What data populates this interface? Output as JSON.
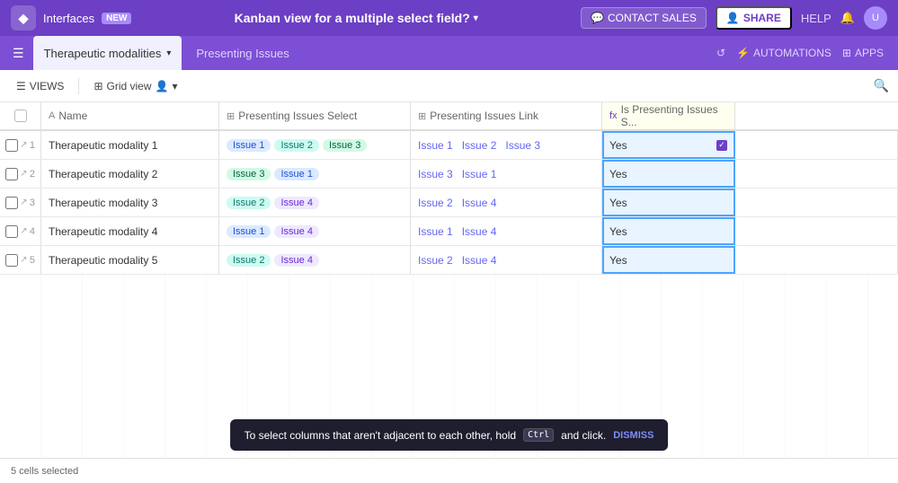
{
  "nav": {
    "logo": "◆",
    "interfaces_label": "Interfaces",
    "new_badge": "NEW",
    "title": "Kanban view for a multiple select field?",
    "title_caret": "▾",
    "contact_sales_label": "CONTACT SALES",
    "share_label": "SHARE",
    "help_label": "HELP",
    "share_icon": "👤"
  },
  "tabs": {
    "active_tab": "Therapeutic modalities",
    "active_tab_arrow": "▾",
    "inactive_tab": "Presenting Issues",
    "hamburger": "☰",
    "automations": "AUTOMATIONS",
    "apps": "APPS",
    "history_icon": "↺"
  },
  "toolbar": {
    "views_label": "VIEWS",
    "grid_view_label": "Grid view",
    "grid_view_icon": "⊞",
    "users_icon": "👤",
    "dropdown_arrow": "▾",
    "search_icon": "🔍"
  },
  "columns": {
    "checkbox": "",
    "name": "Name",
    "name_icon": "A",
    "select": "Presenting Issues Select",
    "select_icon": "⊞",
    "link": "Presenting Issues Link",
    "link_icon": "⊞",
    "formula": "Is Presenting Issues S...",
    "formula_icon": "fx"
  },
  "rows": [
    {
      "num": "1",
      "name": "Therapeutic modality 1",
      "tags_select": [
        {
          "label": "Issue 1",
          "color": "blue"
        },
        {
          "label": "Issue 2",
          "color": "teal"
        },
        {
          "label": "Issue 3",
          "color": "green"
        }
      ],
      "links": [
        "Issue 1",
        "Issue 2",
        "Issue 3"
      ],
      "formula": "Yes",
      "selected": true
    },
    {
      "num": "2",
      "name": "Therapeutic modality 2",
      "tags_select": [
        {
          "label": "Issue 3",
          "color": "green"
        },
        {
          "label": "Issue 1",
          "color": "blue"
        }
      ],
      "links": [
        "Issue 3",
        "Issue 1"
      ],
      "formula": "Yes",
      "selected": true
    },
    {
      "num": "3",
      "name": "Therapeutic modality 3",
      "tags_select": [
        {
          "label": "Issue 2",
          "color": "teal"
        },
        {
          "label": "Issue 4",
          "color": "purple"
        }
      ],
      "links": [
        "Issue 2",
        "Issue 4"
      ],
      "formula": "Yes",
      "selected": true
    },
    {
      "num": "4",
      "name": "Therapeutic modality 4",
      "tags_select": [
        {
          "label": "Issue 1",
          "color": "blue"
        },
        {
          "label": "Issue 4",
          "color": "purple"
        }
      ],
      "links": [
        "Issue 1",
        "Issue 4"
      ],
      "formula": "Yes",
      "selected": true
    },
    {
      "num": "5",
      "name": "Therapeutic modality 5",
      "tags_select": [
        {
          "label": "Issue 2",
          "color": "teal"
        },
        {
          "label": "Issue 4",
          "color": "purple"
        }
      ],
      "links": [
        "Issue 2",
        "Issue 4"
      ],
      "formula": "Yes",
      "selected": true
    }
  ],
  "toast": {
    "message": "To select columns that aren't adjacent to each other, hold",
    "key": "Ctrl",
    "message2": "and click.",
    "dismiss": "DISMISS"
  },
  "status_bar": {
    "text": "5 cells selected"
  },
  "tag_colors": {
    "blue": {
      "bg": "#dbeafe",
      "color": "#1d4ed8"
    },
    "teal": {
      "bg": "#ccfbf1",
      "color": "#0f766e"
    },
    "green": {
      "bg": "#d1fae5",
      "color": "#065f46"
    },
    "purple": {
      "bg": "#ede9fe",
      "color": "#6d28d9"
    },
    "orange": {
      "bg": "#ffedd5",
      "color": "#9a3412"
    }
  }
}
